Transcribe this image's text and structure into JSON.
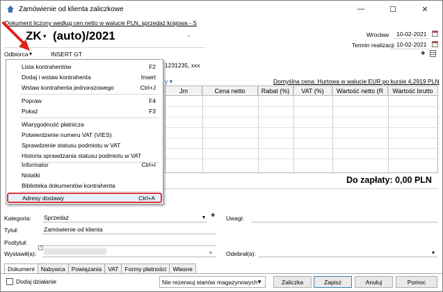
{
  "window": {
    "title": "Zamówienie od klienta zaliczkowe",
    "minimize": "—",
    "maximize": "☐",
    "close": "✕"
  },
  "info_link": "Dokument liczony według cen netto w walucie PLN, sprzedaż krajowa - S",
  "doc": {
    "type": "ZK",
    "number": "(auto)/2021",
    "dash": "-",
    "place": "Wrocław",
    "date": "10-02-2021",
    "realization_label": "Termin realizacji",
    "realization_date": "10-02-2021"
  },
  "recipient": {
    "label": "Odbiorca",
    "value": "INSERT GT",
    "address_fragment": "1231235, xxx"
  },
  "price_link": "Domyślna cena: Hurtowa w walucie EUR po kursie 4,2919 PLN",
  "grid_columns": [
    "Jm",
    "Cena netto",
    "Rabat (%)",
    "VAT (%)",
    "Wartość netto (R",
    "Wartość brutto"
  ],
  "total": "Do zapłaty: 0,00 PLN",
  "menu": {
    "items": [
      {
        "label": "Lista kontrahentów",
        "key": "F2"
      },
      {
        "label": "Dodaj i wstaw kontrahenta",
        "key": "Insert"
      },
      {
        "label": "Wstaw kontrahenta jednorazowego",
        "key": "Ctrl+J"
      },
      {
        "label": "Popraw",
        "key": "F4"
      },
      {
        "label": "Pokaż",
        "key": "F3"
      },
      {
        "label": "Wiarygodność płatnicza",
        "key": ""
      },
      {
        "label": "Potwierdzenie numeru VAT (VIES)",
        "key": ""
      },
      {
        "label": "Sprawdzenie statusu podmiotu w VAT",
        "key": ""
      },
      {
        "label": "Historia sprawdzania statusu podmiotu w VAT",
        "key": ""
      },
      {
        "label": "Informator",
        "key": "Ctrl+I"
      },
      {
        "label": "Notatki",
        "key": ""
      },
      {
        "label": "Biblioteka dokumentów kontrahenta",
        "key": ""
      },
      {
        "label": "Adresy dostawy",
        "key": "Ctrl+A"
      }
    ]
  },
  "fields": {
    "category_label": "Kategoria:",
    "category_value": "Sprzedaż",
    "title_label": "Tytuł:",
    "title_value": "Zamówienie od klienta",
    "subtitle_label": "Podtytuł:",
    "issued_label": "Wystawił(a):",
    "notes_label": "Uwagi:",
    "received_label": "Odebrał(a):"
  },
  "tabs": [
    "Dokument",
    "Nabywca",
    "Powiązania",
    "VAT",
    "Formy płatności",
    "Własne"
  ],
  "footer": {
    "add_action": "Dodaj działanie",
    "reserve_select": "Nie rezerwuj stanów magazynowych",
    "buttons": [
      "Zaliczka",
      "Zapisz",
      "Anuluj",
      "Pomoc"
    ]
  },
  "colors": {
    "highlight_border": "#d9363e",
    "arrow": "#e0201b",
    "link_blue": "#1f5fb0"
  }
}
